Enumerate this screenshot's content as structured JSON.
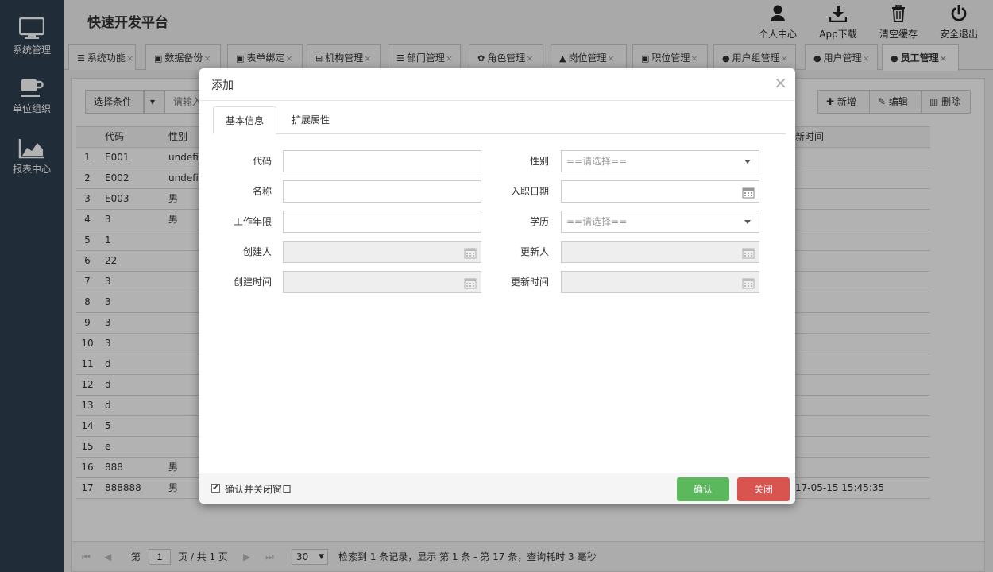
{
  "sidebar": {
    "items": [
      {
        "label": "系统管理",
        "icon": "monitor-icon"
      },
      {
        "label": "单位组织",
        "icon": "coffee-cup-icon"
      },
      {
        "label": "报表中心",
        "icon": "area-chart-icon"
      }
    ]
  },
  "header": {
    "title": "快速开发平台",
    "buttons": [
      {
        "label": "个人中心",
        "icon": "user-icon"
      },
      {
        "label": "App下载",
        "icon": "download-icon"
      },
      {
        "label": "清空缓存",
        "icon": "trash-icon"
      },
      {
        "label": "安全退出",
        "icon": "power-icon"
      }
    ]
  },
  "tabs": [
    {
      "label": "系统功能",
      "icon": "list-icon"
    },
    {
      "label": "数据备份",
      "icon": "briefcase-icon"
    },
    {
      "label": "表单绑定",
      "icon": "briefcase-icon"
    },
    {
      "label": "机构管理",
      "icon": "sitemap-icon"
    },
    {
      "label": "部门管理",
      "icon": "list-icon"
    },
    {
      "label": "角色管理",
      "icon": "paw-icon"
    },
    {
      "label": "岗位管理",
      "icon": "graduation-cap-icon"
    },
    {
      "label": "职位管理",
      "icon": "briefcase-icon"
    },
    {
      "label": "用户组管理",
      "icon": "users-icon"
    },
    {
      "label": "用户管理",
      "icon": "user-icon"
    },
    {
      "label": "员工管理",
      "icon": "users-icon",
      "active": true
    }
  ],
  "toolbar": {
    "select_label": "选择条件",
    "search_placeholder": "请输入",
    "add_label": "新增",
    "edit_label": "编辑",
    "delete_label": "删除"
  },
  "grid": {
    "columns": [
      "代码",
      "性别",
      "新时间"
    ],
    "rows": [
      {
        "n": "1",
        "code": "E001",
        "gender": "undefin",
        "time": ""
      },
      {
        "n": "2",
        "code": "E002",
        "gender": "undefin",
        "time": ""
      },
      {
        "n": "3",
        "code": "E003",
        "gender": "男",
        "time": ""
      },
      {
        "n": "4",
        "code": "3",
        "gender": "男",
        "time": ""
      },
      {
        "n": "5",
        "code": "1",
        "gender": "",
        "time": ""
      },
      {
        "n": "6",
        "code": "22",
        "gender": "",
        "time": ""
      },
      {
        "n": "7",
        "code": "3",
        "gender": "",
        "time": ""
      },
      {
        "n": "8",
        "code": "3",
        "gender": "",
        "time": ""
      },
      {
        "n": "9",
        "code": "3",
        "gender": "",
        "time": ""
      },
      {
        "n": "10",
        "code": "3",
        "gender": "",
        "time": ""
      },
      {
        "n": "11",
        "code": "d",
        "gender": "",
        "time": ""
      },
      {
        "n": "12",
        "code": "d",
        "gender": "",
        "time": ""
      },
      {
        "n": "13",
        "code": "d",
        "gender": "",
        "time": ""
      },
      {
        "n": "14",
        "code": "5",
        "gender": "",
        "time": ""
      },
      {
        "n": "15",
        "code": "e",
        "gender": "",
        "time": ""
      },
      {
        "n": "16",
        "code": "888",
        "gender": "男",
        "time": ""
      },
      {
        "n": "17",
        "code": "888888",
        "gender": "男",
        "time": "17-05-15 15:45:35"
      }
    ]
  },
  "pager": {
    "page_prefix": "第",
    "page_value": "1",
    "page_suffix": "页 / 共 1 页",
    "page_size": "30",
    "status": "检索到 1 条记录，显示 第 1 条 - 第 17 条，查询耗时 3 毫秒"
  },
  "dialog": {
    "title": "添加",
    "close": "×",
    "tabs": [
      "基本信息",
      "扩展属性"
    ],
    "fields": {
      "code": {
        "label": "代码",
        "value": ""
      },
      "name": {
        "label": "名称",
        "value": ""
      },
      "work_years": {
        "label": "工作年限",
        "value": ""
      },
      "creator": {
        "label": "创建人",
        "value": ""
      },
      "create_time": {
        "label": "创建时间",
        "value": ""
      },
      "gender": {
        "label": "性别",
        "value": "==请选择=="
      },
      "hire_date": {
        "label": "入职日期",
        "value": ""
      },
      "education": {
        "label": "学历",
        "value": "==请选择=="
      },
      "updater": {
        "label": "更新人",
        "value": ""
      },
      "update_time": {
        "label": "更新时间",
        "value": ""
      }
    },
    "footer": {
      "checkbox_label": "确认并关闭窗口",
      "checkbox_checked": true,
      "confirm_label": "确认",
      "close_label": "关闭"
    }
  },
  "colors": {
    "sidebar_bg": "#2f4050",
    "confirm_green": "#5cb85c",
    "close_red": "#d9534f"
  }
}
